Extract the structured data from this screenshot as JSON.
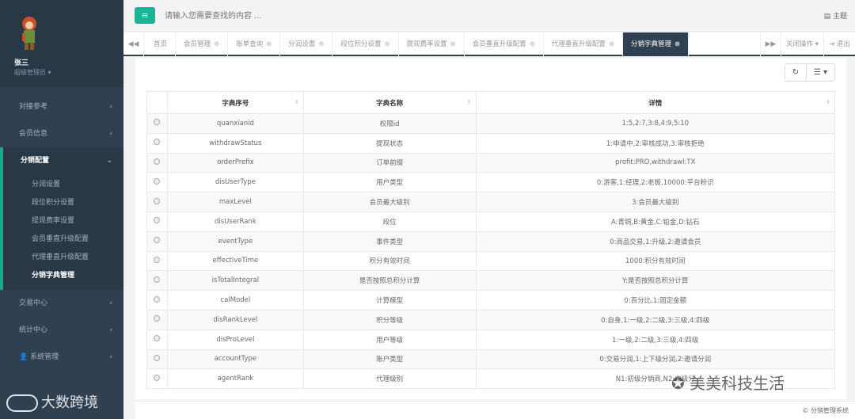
{
  "user": {
    "name": "张三",
    "role": "超级管理员 ▾"
  },
  "sidebar": {
    "items": [
      {
        "label": "对接参考",
        "chev": "‹"
      },
      {
        "label": "会员信息",
        "chev": "‹"
      },
      {
        "label": "分销配置",
        "chev": "⌄"
      },
      {
        "label": "交易中心",
        "chev": "‹"
      },
      {
        "label": "统计中心",
        "chev": "‹"
      },
      {
        "label": "系统管理",
        "chev": "‹"
      }
    ],
    "subitems": [
      "分润设置",
      "段位积分设置",
      "提现费率设置",
      "会员垂直升级配置",
      "代理垂直升级配置",
      "分销字典管理"
    ]
  },
  "topbar": {
    "menu_icon": "≡",
    "search_placeholder": "请输入您需要查找的内容 ...",
    "theme": "▤ 主题"
  },
  "tabs": {
    "nav_left": "◀◀",
    "nav_right": "▶▶",
    "close_ops": "关闭操作 ▾",
    "logout": "⇥ 退出",
    "items": [
      "首页",
      "会员管理",
      "账单查询",
      "分润设置",
      "段位积分设置",
      "提现费率设置",
      "会员垂直升级配置",
      "代理垂直升级配置",
      "分销字典管理"
    ],
    "close_glyph": "⊗"
  },
  "toolbar": {
    "refresh": "↻",
    "columns": "☰ ▾"
  },
  "table": {
    "headers": [
      "字典序号",
      "字典名称",
      "详情"
    ],
    "sort_glyph": "⇕",
    "rows": [
      [
        "quanxianid",
        "权限id",
        "1:5,2:7,3:8,4:9,5:10"
      ],
      [
        "withdrawStatus",
        "提现状态",
        "1:申请中,2:审核成功,3:审核拒绝"
      ],
      [
        "orderPrefix",
        "订单前缀",
        "profit:PRO,withdrawl:TX"
      ],
      [
        "disUserType",
        "用户类型",
        "0:游客,1:经理,2:老板,10000:平台粉识"
      ],
      [
        "maxLevel",
        "会员最大级别",
        "3:会员最大级别"
      ],
      [
        "disUserRank",
        "段位",
        "A:青铜,B:黄金,C:铂金,D:钻石"
      ],
      [
        "eventType",
        "事件类型",
        "0:商品交易,1:升级,2:邀请会员"
      ],
      [
        "effectiveTime",
        "积分有效时间",
        "1000:积分有效时间"
      ],
      [
        "isTotalIntegral",
        "是否按照总积分计算",
        "Y:是否按照总积分计算"
      ],
      [
        "calModel",
        "计算模型",
        "0:百分比,1:固定金额"
      ],
      [
        "disRankLevel",
        "积分等级",
        "0:自身,1:一级,2:二级,3:三级,4:四级"
      ],
      [
        "disProLevel",
        "用户等级",
        "1:一级,2:二级,3:三级,4:四级"
      ],
      [
        "accountType",
        "账户类型",
        "0:交易分润,1:上下级分润,2:邀请分润"
      ],
      [
        "agentRank",
        "代理级别",
        "N1:初级分销商,N2:中级分"
      ]
    ]
  },
  "footer": {
    "copyright": "© 分销管理系统"
  },
  "watermarks": {
    "left": "大数跨境",
    "right": "美美科技生活"
  }
}
